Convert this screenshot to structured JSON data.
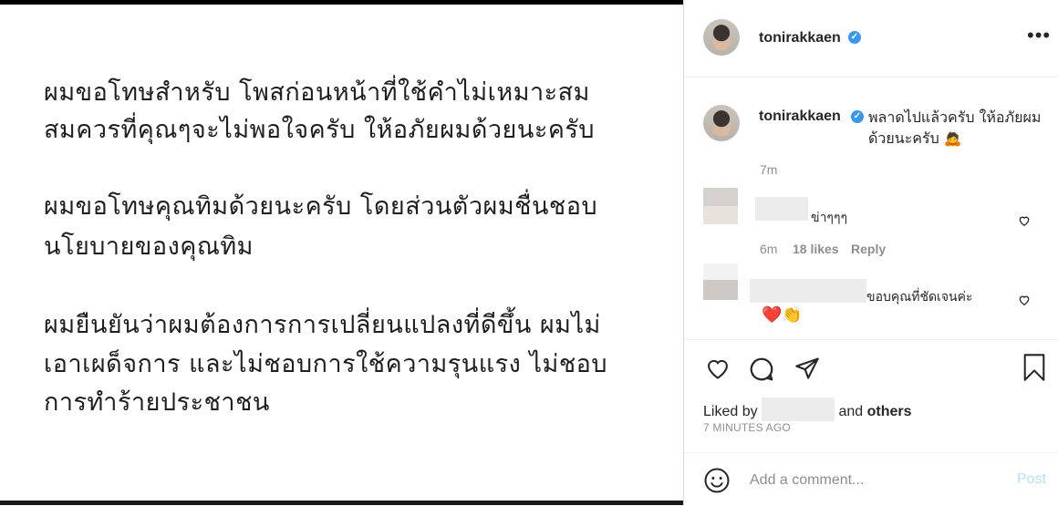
{
  "post_image": {
    "lines": [
      "ผมขอโทษสำหรับ โพสก่อนหน้าที่ใช้คำไม่เหมาะสม",
      "สมควรที่คุณๆจะไม่พอใจครับ  ให้อภัยผมด้วยนะครับ",
      "ผมขอโทษคุณทิมด้วยนะครับ  โดยส่วนตัวผมชื่นชอบ",
      "นโยบายของคุณทิม",
      "ผมยืนยันว่าผมต้องการการเปลี่ยนแปลงที่ดีขึ้น ผมไม่",
      "เอาเผด็จการ และไม่ชอบการใช้ความรุนแรง ไม่ชอบ",
      "การทำร้ายประชาชน"
    ]
  },
  "header": {
    "username": "tonirakkaen",
    "verified_icon": "verified-check-icon",
    "more_icon": "•••"
  },
  "caption": {
    "username": "tonirakkaen",
    "text": "พลาดไปแล้วครับ ให้อภัยผมด้วยนะครับ 🙇",
    "time": "7m"
  },
  "comments": [
    {
      "text": "ข่าๆๆๆ",
      "time": "6m",
      "likes": "18 likes",
      "reply": "Reply"
    },
    {
      "text": "ขอบคุณที่ชัดเจนค่ะ",
      "emojis": "❤️👏"
    }
  ],
  "actions": {
    "liked_by_prefix": "Liked by",
    "liked_by_suffix_and": "and",
    "liked_by_others": "others",
    "posted_time": "7 MINUTES AGO"
  },
  "comment_bar": {
    "placeholder": "Add a comment...",
    "post_label": "Post"
  },
  "colors": {
    "accent": "#3897f0",
    "post_disabled": "#b2dffc",
    "meta_gray": "#8e8e8e"
  }
}
